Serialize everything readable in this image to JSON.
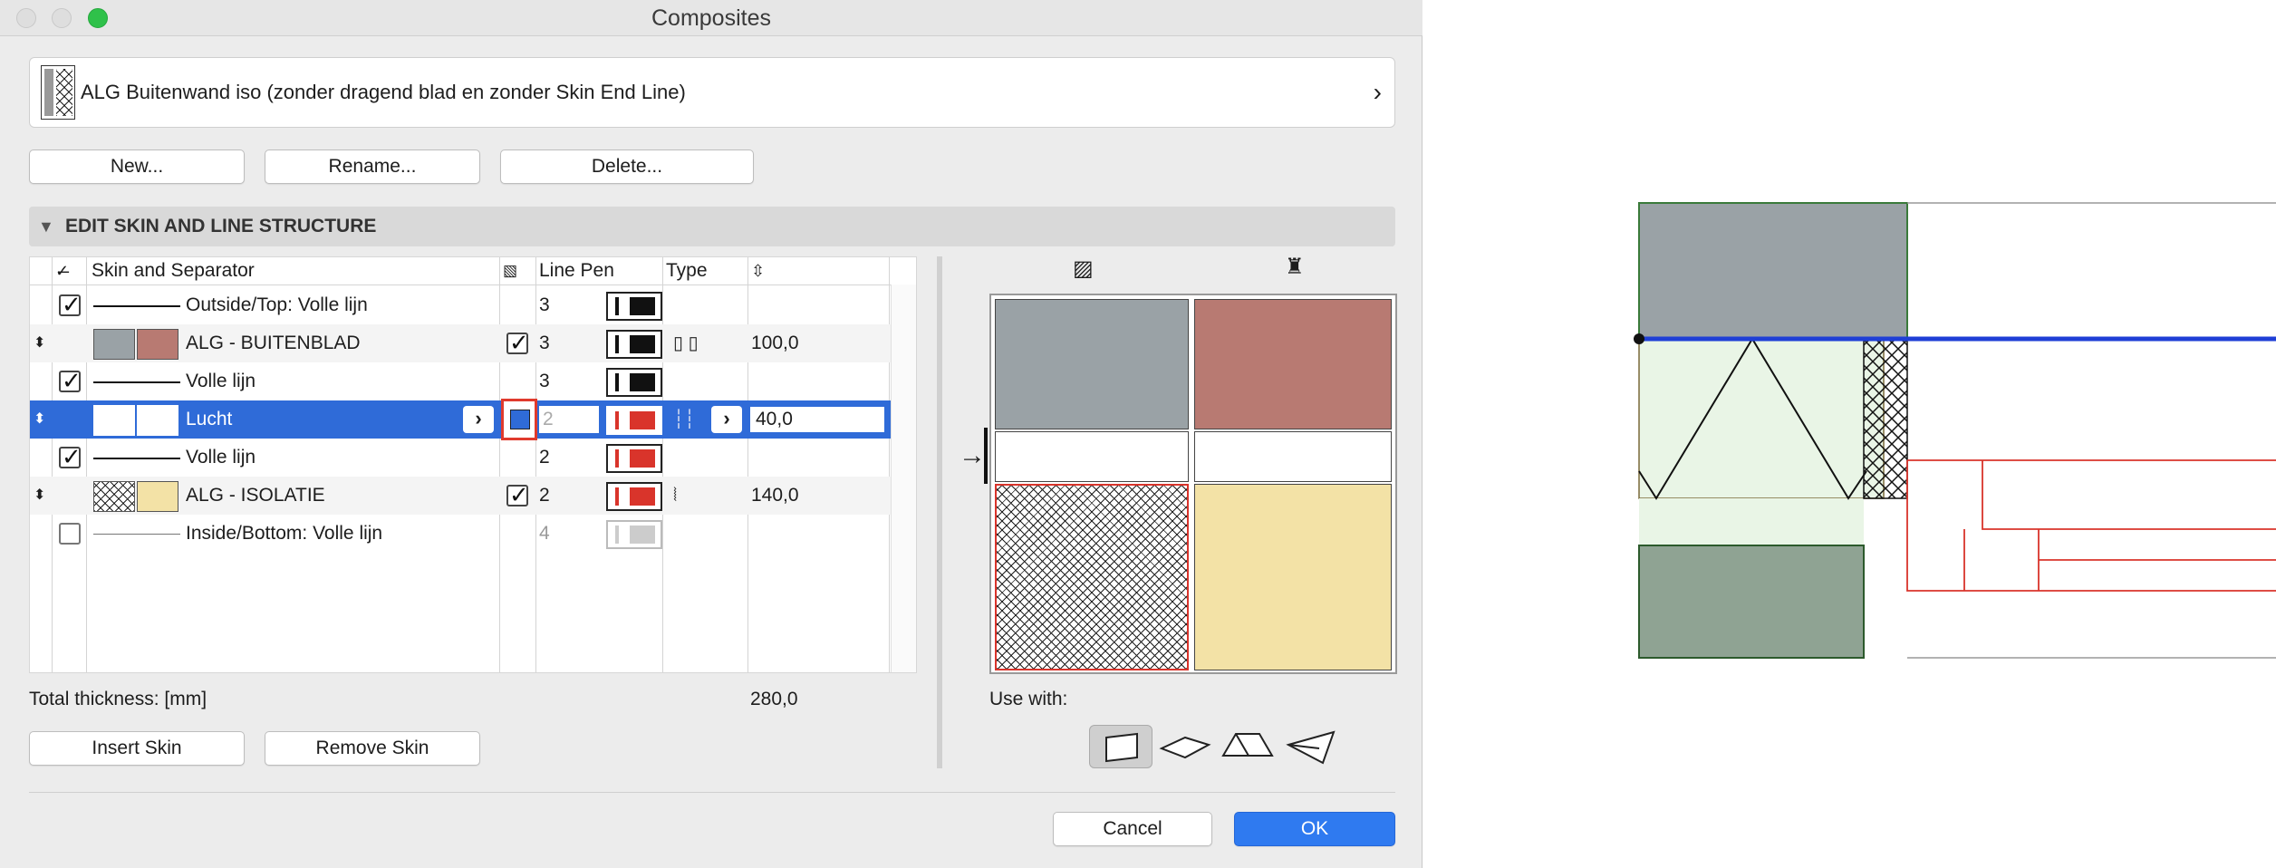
{
  "window": {
    "title": "Composites"
  },
  "composite": {
    "name": "ALG Buitenwand iso (zonder dragend blad en zonder Skin End Line)",
    "chevron": "›"
  },
  "top_buttons": {
    "new": "New...",
    "rename": "Rename...",
    "delete": "Delete..."
  },
  "section": {
    "title": "EDIT SKIN AND LINE STRUCTURE"
  },
  "table": {
    "headers": {
      "skin_separator": "Skin and Separator",
      "line_pen": "Line Pen",
      "type": "Type"
    },
    "rows": [
      {
        "name": "Outside/Top: Volle lijn",
        "pen": "3",
        "thickness": ""
      },
      {
        "name": "ALG - BUITENBLAD",
        "pen": "3",
        "thickness": "100,0"
      },
      {
        "name": "Volle lijn",
        "pen": "3",
        "thickness": ""
      },
      {
        "name": "Lucht",
        "pen": "2",
        "thickness": "40,0"
      },
      {
        "name": "Volle lijn",
        "pen": "2",
        "thickness": ""
      },
      {
        "name": "ALG - ISOLATIE",
        "pen": "2",
        "thickness": "140,0"
      },
      {
        "name": "Inside/Bottom: Volle lijn",
        "pen": "4",
        "thickness": ""
      }
    ]
  },
  "totals": {
    "label": "Total thickness: [mm]",
    "value": "280,0"
  },
  "bottom_buttons": {
    "insert": "Insert Skin",
    "remove": "Remove Skin"
  },
  "preview": {
    "use_with": "Use with:"
  },
  "footer": {
    "cancel": "Cancel",
    "ok": "OK"
  },
  "colors": {
    "selection": "#2f6bd8",
    "gray_fill": "#9aa2a6",
    "brick_fill": "#b87a72",
    "insulation_fill": "#f3e2a6",
    "drawing_green": "#e9f5e6",
    "drawing_blue": "#1f3fd6",
    "drawing_red": "#d9342b"
  },
  "icons": [
    "hatch-pattern-icon",
    "paint-brush-icon",
    "wall-tool-icon",
    "slab-tool-icon",
    "roof-tool-icon",
    "shell-tool-icon",
    "double-arrow-icon",
    "arrow-right-icon"
  ]
}
